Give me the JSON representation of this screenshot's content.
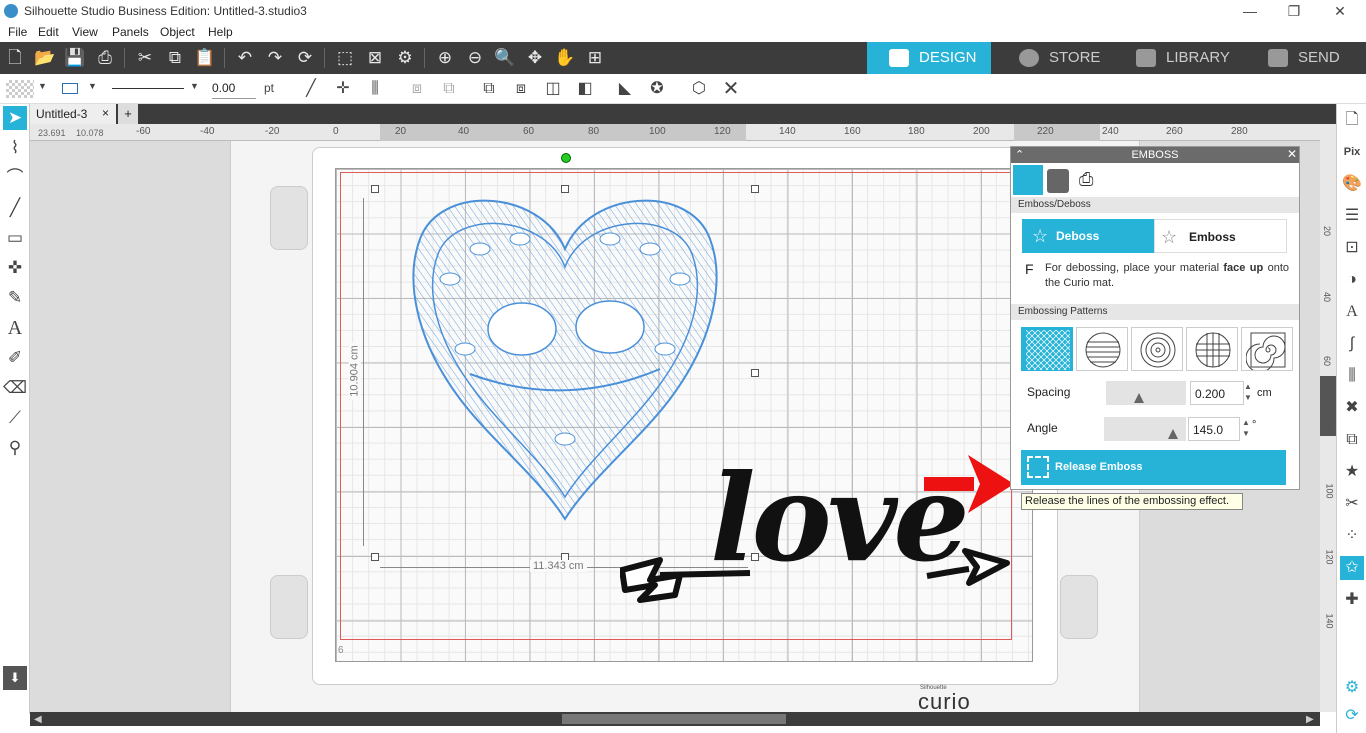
{
  "window": {
    "title": "Silhouette Studio Business Edition: Untitled-3.studio3"
  },
  "menu": [
    "File",
    "Edit",
    "View",
    "Panels",
    "Object",
    "Help"
  ],
  "nav_tabs": [
    "DESIGN",
    "STORE",
    "LIBRARY",
    "SEND"
  ],
  "toolbar2": {
    "line_width": "0.00",
    "line_unit": "pt"
  },
  "doc_tab": {
    "name": "Untitled-3",
    "close": "×",
    "add": "+"
  },
  "coords": {
    "x": "23.691",
    "y": "10.078"
  },
  "ruler_h": [
    "-60",
    "-40",
    "-20",
    "0",
    "20",
    "40",
    "60",
    "80",
    "100",
    "120",
    "140",
    "160",
    "180",
    "200",
    "220",
    "240",
    "260",
    "280"
  ],
  "ruler_v": [
    "20",
    "40",
    "60",
    "80",
    "100",
    "120",
    "140"
  ],
  "canvas": {
    "dim_height": "10.904 cm",
    "dim_width": "11.343 cm",
    "page_number": "6",
    "love_text": "love",
    "brand_small": "Silhouette",
    "brand": "curio"
  },
  "emboss_panel": {
    "title": "EMBOSS",
    "section1": "Emboss/Deboss",
    "deboss_label": "Deboss",
    "emboss_label": "Emboss",
    "instruction_letter": "F",
    "instruction_pre": "For debossing, place your material ",
    "instruction_bold": "face up",
    "instruction_post": " onto the Curio mat.",
    "section2": "Embossing Patterns",
    "spacing_label": "Spacing",
    "spacing_value": "0.200",
    "spacing_unit": "cm",
    "angle_label": "Angle",
    "angle_value": "145.0",
    "angle_unit": "°",
    "release_label": "Release Emboss",
    "tooltip": "Release the lines of the embossing effect."
  },
  "colors": {
    "accent": "#27b3d8",
    "toolbar": "#3c3c3c",
    "design_line": "#4a90d9",
    "arrow": "#ee1111"
  }
}
